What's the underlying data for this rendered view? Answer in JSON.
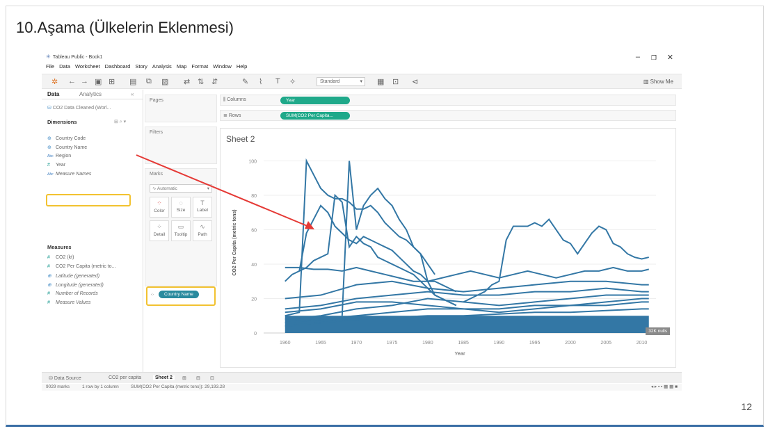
{
  "slide": {
    "title": "10.Aşama (Ülkelerin Eklenmesi)",
    "page_number": "12"
  },
  "app": {
    "title": "Tableau Public - Book1",
    "menu": [
      "File",
      "Data",
      "Worksheet",
      "Dashboard",
      "Story",
      "Analysis",
      "Map",
      "Format",
      "Window",
      "Help"
    ],
    "toolbar": {
      "fit_label": "Standard",
      "show_me": "Show Me"
    },
    "data_pane": {
      "tabs": [
        "Data",
        "Analytics"
      ],
      "source": "CO2 Data Cleaned (Worl...",
      "dimensions_header": "Dimensions",
      "dimensions": [
        {
          "label": "Country Code",
          "icon": "globe-icon"
        },
        {
          "label": "Country Name",
          "icon": "globe-icon"
        },
        {
          "label": "Region",
          "icon": "abc-icon"
        },
        {
          "label": "Year",
          "icon": "hash-icon"
        },
        {
          "label": "Measure Names",
          "icon": "abc-icon"
        }
      ],
      "measures_header": "Measures",
      "measures": [
        {
          "label": "CO2 (kt)",
          "icon": "hash-icon"
        },
        {
          "label": "CO2 Per Capita (metric to...",
          "icon": "hash-icon"
        },
        {
          "label": "Latitude (generated)",
          "icon": "globe-icon"
        },
        {
          "label": "Longitude (generated)",
          "icon": "globe-icon"
        },
        {
          "label": "Number of Records",
          "icon": "hash-icon"
        },
        {
          "label": "Measure Values",
          "icon": "hash-icon"
        }
      ]
    },
    "cards": {
      "pages": "Pages",
      "filters": "Filters",
      "marks": "Marks",
      "mark_type": "Automatic",
      "buttons": [
        "Color",
        "Size",
        "Label",
        "Detail",
        "Tooltip",
        "Path"
      ],
      "detail_pill": "Country Name"
    },
    "shelves": {
      "columns_label": "Columns",
      "columns_pill": "Year",
      "rows_label": "Rows",
      "rows_pill": "SUM(CO2 Per Capita..."
    },
    "sheet": {
      "title": "Sheet 2",
      "nulls_badge": "32K nulls"
    },
    "tabs_bottom": [
      "Data Source",
      "CO2 per capita",
      "Sheet 2"
    ],
    "status": {
      "marks": "9029 marks",
      "rows": "1 row by 1 column",
      "sum": "SUM(CO2 Per Capita (metric tons)): 29,193.28"
    }
  },
  "chart_data": {
    "type": "line",
    "xlabel": "Year",
    "ylabel": "CO2 Per Capita (metric tons)",
    "xlim": [
      1957,
      2012
    ],
    "ylim": [
      0,
      105
    ],
    "x_ticks": [
      1960,
      1965,
      1970,
      1975,
      1980,
      1985,
      1990,
      1995,
      2000,
      2005,
      2010
    ],
    "y_ticks": [
      0,
      20,
      40,
      60,
      80,
      100
    ],
    "series": [
      {
        "x": [
          1960,
          1961,
          1962,
          1963,
          1964,
          1965,
          1966,
          1967,
          1968,
          1969,
          1970,
          1971,
          1972,
          1973,
          1974,
          1975,
          1976,
          1977,
          1978,
          1979,
          1980,
          1981,
          1982,
          1983,
          1984
        ],
        "values": [
          30,
          34,
          36,
          38,
          42,
          44,
          46,
          80,
          76,
          50,
          56,
          52,
          50,
          44,
          42,
          40,
          38,
          36,
          34,
          30,
          26,
          22,
          20,
          18,
          16
        ]
      },
      {
        "x": [
          1960,
          1962,
          1963,
          1964,
          1965,
          1966,
          1967,
          1968,
          1969,
          1970,
          1971,
          1972,
          1973,
          1974,
          1975,
          1976,
          1977,
          1978,
          1979,
          1980,
          1981
        ],
        "values": [
          10,
          12,
          100,
          92,
          84,
          80,
          78,
          78,
          76,
          72,
          72,
          74,
          70,
          64,
          60,
          56,
          54,
          50,
          46,
          40,
          34
        ]
      },
      {
        "x": [
          1968,
          1969,
          1970,
          1971,
          1972,
          1973,
          1974,
          1975,
          1976,
          1977,
          1978,
          1979,
          1980,
          1981,
          1982,
          1983,
          1984
        ],
        "values": [
          10,
          100,
          60,
          74,
          80,
          84,
          78,
          74,
          66,
          60,
          50,
          46,
          30,
          22,
          20,
          18,
          16
        ]
      },
      {
        "x": [
          1962,
          1963,
          1964,
          1965,
          1966,
          1967,
          1968,
          1969,
          1970,
          1971,
          1972,
          1973,
          1974,
          1975,
          1976,
          1977,
          1978,
          1979,
          1980,
          1981,
          1982,
          1983,
          1984
        ],
        "values": [
          36,
          58,
          66,
          74,
          70,
          62,
          58,
          54,
          52,
          56,
          54,
          52,
          50,
          48,
          44,
          40,
          36,
          34,
          30,
          30,
          28,
          26,
          24
        ]
      },
      {
        "x": [
          1985,
          1986,
          1987,
          1988,
          1989,
          1990,
          1991,
          1992,
          1993,
          1994,
          1995,
          1996,
          1997,
          1998,
          1999,
          2000,
          2001,
          2002,
          2003,
          2004,
          2005,
          2006,
          2007,
          2008,
          2009,
          2010,
          2011
        ],
        "values": [
          18,
          20,
          22,
          24,
          28,
          30,
          54,
          62,
          62,
          62,
          64,
          62,
          66,
          60,
          54,
          52,
          46,
          52,
          58,
          62,
          60,
          52,
          50,
          46,
          44,
          43,
          44
        ]
      },
      {
        "x": [
          1960,
          1962,
          1964,
          1966,
          1968,
          1970,
          1972,
          1974,
          1976,
          1978,
          1980,
          1982,
          1984,
          1986,
          1988,
          1990,
          1992,
          1994,
          1996,
          1998,
          2000,
          2002,
          2004,
          2006,
          2008,
          2010,
          2011
        ],
        "values": [
          38,
          38,
          37,
          37,
          36,
          38,
          36,
          34,
          32,
          30,
          30,
          32,
          34,
          36,
          34,
          32,
          34,
          36,
          34,
          32,
          34,
          36,
          36,
          38,
          36,
          36,
          37
        ]
      },
      {
        "x": [
          1960,
          1965,
          1970,
          1975,
          1980,
          1985,
          1990,
          1995,
          2000,
          2005,
          2010,
          2011
        ],
        "values": [
          20,
          22,
          28,
          30,
          26,
          24,
          26,
          28,
          30,
          30,
          28,
          28
        ]
      },
      {
        "x": [
          1960,
          1965,
          1970,
          1975,
          1980,
          1985,
          1990,
          1995,
          2000,
          2005,
          2010,
          2011
        ],
        "values": [
          14,
          16,
          20,
          22,
          24,
          22,
          22,
          24,
          24,
          26,
          24,
          24
        ]
      },
      {
        "x": [
          1960,
          1965,
          1970,
          1975,
          1980,
          1985,
          1990,
          1995,
          2000,
          2005,
          2010,
          2011
        ],
        "values": [
          8,
          10,
          14,
          16,
          20,
          18,
          16,
          18,
          20,
          22,
          22,
          22
        ]
      },
      {
        "x": [
          1960,
          1965,
          1970,
          1975,
          1980,
          1985,
          1990,
          1995,
          2000,
          2005,
          2010,
          2011
        ],
        "values": [
          12,
          14,
          18,
          18,
          16,
          14,
          12,
          14,
          16,
          16,
          18,
          18
        ]
      },
      {
        "x": [
          1960,
          1965,
          1970,
          1975,
          1980,
          1985,
          1990,
          1995,
          2000,
          2005,
          2010,
          2011
        ],
        "values": [
          6,
          8,
          10,
          12,
          14,
          14,
          14,
          16,
          16,
          18,
          20,
          20
        ]
      },
      {
        "x": [
          1960,
          1965,
          1970,
          1975,
          1980,
          1985,
          1990,
          1995,
          2000,
          2005,
          2010,
          2011
        ],
        "values": [
          4,
          6,
          8,
          9,
          10,
          10,
          11,
          12,
          12,
          13,
          14,
          14
        ]
      }
    ]
  },
  "colors": {
    "line": "#3377a5",
    "pill_green": "#1fa98a",
    "highlight": "#f2c230",
    "arrow": "#e53935",
    "slide_border": "#3a6ea5"
  }
}
